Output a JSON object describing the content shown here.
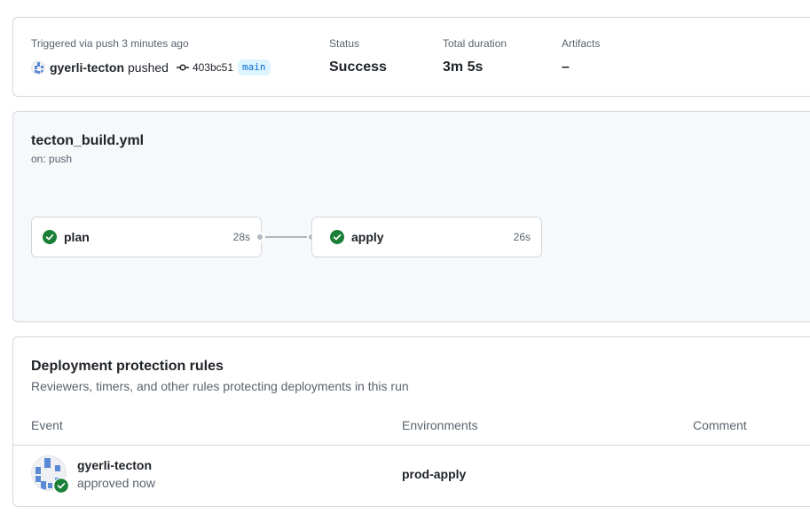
{
  "summary": {
    "trigger_label": "Triggered via push 3 minutes ago",
    "actor": "gyerli-tecton",
    "action": "pushed",
    "commit_icon": "git-commit-icon",
    "commit_sha": "403bc51",
    "branch": "main",
    "status_label": "Status",
    "status_value": "Success",
    "duration_label": "Total duration",
    "duration_value": "3m 5s",
    "artifacts_label": "Artifacts",
    "artifacts_value": "–"
  },
  "workflow": {
    "file": "tecton_build.yml",
    "trigger": "on: push",
    "jobs": [
      {
        "name": "plan",
        "duration": "28s",
        "status": "success",
        "icon": "check-circle-icon"
      },
      {
        "name": "apply",
        "duration": "26s",
        "status": "success",
        "icon": "check-circle-icon"
      }
    ]
  },
  "deployment": {
    "title": "Deployment protection rules",
    "subtitle": "Reviewers, timers, and other rules protecting deployments in this run",
    "columns": [
      "Event",
      "Environments",
      "Comment"
    ],
    "rows": [
      {
        "reviewer": "gyerli-tecton",
        "event": "approved now",
        "environment": "prod-apply",
        "comment": ""
      }
    ]
  },
  "colors": {
    "success": "#1a7f37",
    "accent": "#0969da",
    "branch_bg": "#ddf4ff",
    "muted_text": "#59636e",
    "border": "#d1d9e0",
    "canvas_subtle": "#f6f8fa"
  }
}
